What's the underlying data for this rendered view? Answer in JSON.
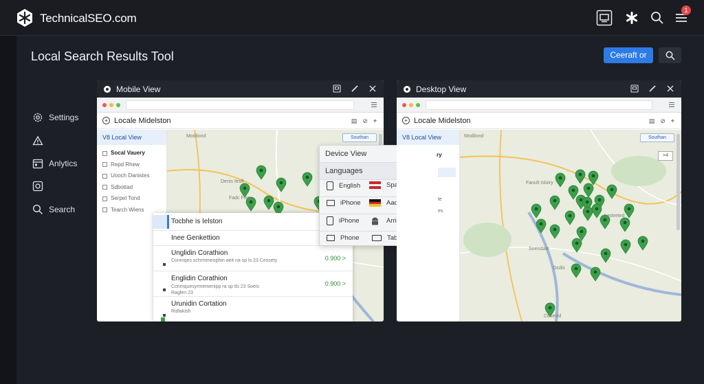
{
  "app": {
    "brand": "TechnicalSEO.com",
    "notification_count": "1"
  },
  "header": {
    "title": "Local Search Results Tool",
    "primary_button": "Ceeraft or"
  },
  "nav": [
    {
      "label": "Settings",
      "icon": "gear-icon"
    },
    {
      "label": "",
      "icon": "alert-icon"
    },
    {
      "label": "Anlytics",
      "icon": "calendar-icon"
    },
    {
      "label": "",
      "icon": "instagram-icon"
    },
    {
      "label": "Search",
      "icon": "search-icon"
    }
  ],
  "mobile_panel": {
    "title": "Mobile View",
    "app_title": "Locale Midelston",
    "selected_view": "V8 Local View",
    "map_label": "Modilond",
    "map_button": "Southan",
    "sidebar": [
      "Socal Vauery",
      "Repd Rhew",
      "Uooch Danistes",
      "Sdbottad",
      "Serpel Tond",
      "Tearch Wiens"
    ],
    "map_places": [
      "Denis Itraft",
      "Fadc Flas"
    ],
    "results_card": {
      "header": "Tocbhe is Ielston",
      "subheader": "Inee Genkettion",
      "results": [
        {
          "title": "Unglidin Corathion",
          "desc": "Conmqes schrmmeophin aeit na sp ls 23 Cessety",
          "score": "0.900 >"
        },
        {
          "title": "Englidin Corathion",
          "desc": "Conmquesyrmemenipp ra sp tls 23 Soeis\nRaglen 23",
          "score": "0.900 >"
        },
        {
          "title": "Urunidin Cortation",
          "desc": "Ridlakish",
          "score": ""
        }
      ]
    }
  },
  "dropdown": {
    "device_view_label": "Device View",
    "languages_label": "Languages",
    "options": [
      {
        "left": "English",
        "right": "Spanish",
        "left_icon": "phone-icon",
        "right_icon": "flag-spain-icon"
      },
      {
        "left": "iPhone",
        "right": "Aadroid",
        "left_icon": "tablet-wide-icon",
        "right_icon": "flag-germany-icon"
      },
      {
        "left": "iPhone",
        "right": "Arriet",
        "left_icon": "phone-icon",
        "right_icon": "android-icon"
      },
      {
        "left": "Phone",
        "right": "Tablet",
        "left_icon": "monitor-icon",
        "right_icon": "tablet-icon"
      }
    ]
  },
  "desktop_panel": {
    "title": "Desktop View",
    "app_title": "Locale Midelston",
    "selected_view": "V8 Local View",
    "map_label": "Modilond",
    "map_button": "Southan",
    "zoom_control": ">4",
    "sidebar": [
      "ry",
      "le",
      "es"
    ],
    "map_places": [
      "Fanult Isloiry",
      "Leotreted",
      "Soendale",
      "Ocdis",
      "Ceselvd"
    ]
  },
  "colors": {
    "accent": "#2d7be5",
    "pin": "#3aa04a",
    "map_water": "#9fb7d8",
    "map_road": "#f3c25b"
  }
}
